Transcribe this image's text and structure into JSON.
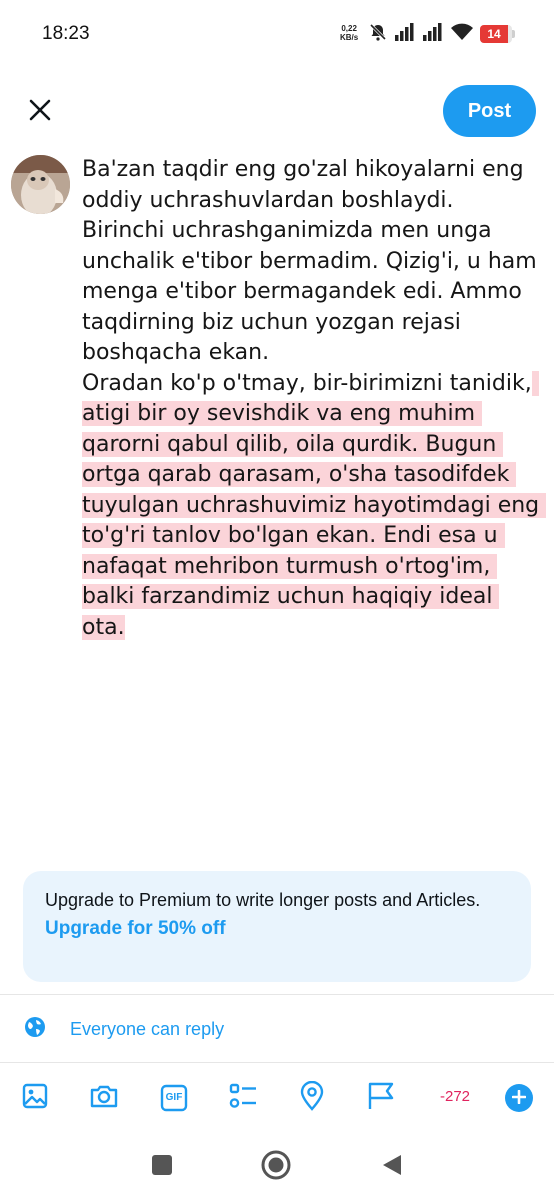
{
  "status_bar": {
    "time": "18:23",
    "net_speed_value": "0,22",
    "net_speed_unit": "KB/s",
    "battery_level": "14",
    "battery_fraction": 0.14,
    "icons": [
      "mute-bell-icon",
      "signal-icon",
      "signal-icon",
      "wifi-icon",
      "battery-icon"
    ]
  },
  "header": {
    "close_icon": "close-icon",
    "post_label": "Post"
  },
  "composer": {
    "text_within_limit": "Ba'zan taqdir eng go'zal hikoyalarni eng oddiy uchrashuvlardan boshlaydi. Birinchi uchrashganimizda men unga unchalik e'tibor bermadim. Qizig'i, u ham menga e'tibor bermagandek edi. Ammo taqdirning biz uchun yozgan rejasi boshqacha ekan.\nOradan ko'p o'tmay, bir-birimizni tanidik,",
    "text_over_limit": " atigi bir oy sevishdik va eng muhim qarorni qabul qilib, oila qurdik. Bugun ortga qarab qarasam, o'sha tasodifdek tuyulgan uchrashuvimiz hayotimdagi eng to'g'ri tanlov bo'lgan ekan. Endi esa u nafaqat mehribon turmush o'rtog'im, balki farzandimiz uchun haqiqiy ideal ota."
  },
  "premium_card": {
    "text": "Upgrade to Premium to write longer posts and Articles.",
    "link": "Upgrade for 50% off"
  },
  "reply": {
    "label": "Everyone can reply"
  },
  "toolbar": {
    "icons": [
      "image-icon",
      "camera-icon",
      "gif-icon",
      "poll-icon",
      "location-icon",
      "flag-icon"
    ],
    "gif_text": "GIF",
    "char_count": "-272",
    "add_icon": "plus-icon"
  },
  "colors": {
    "accent": "#1d9bf0",
    "over_limit_highlight": "#fbd4d9",
    "over_limit_text": "#e0245e",
    "battery_low": "#e53935"
  },
  "nav": {
    "icons": [
      "recents-square-icon",
      "home-circle-icon",
      "back-triangle-icon"
    ]
  }
}
